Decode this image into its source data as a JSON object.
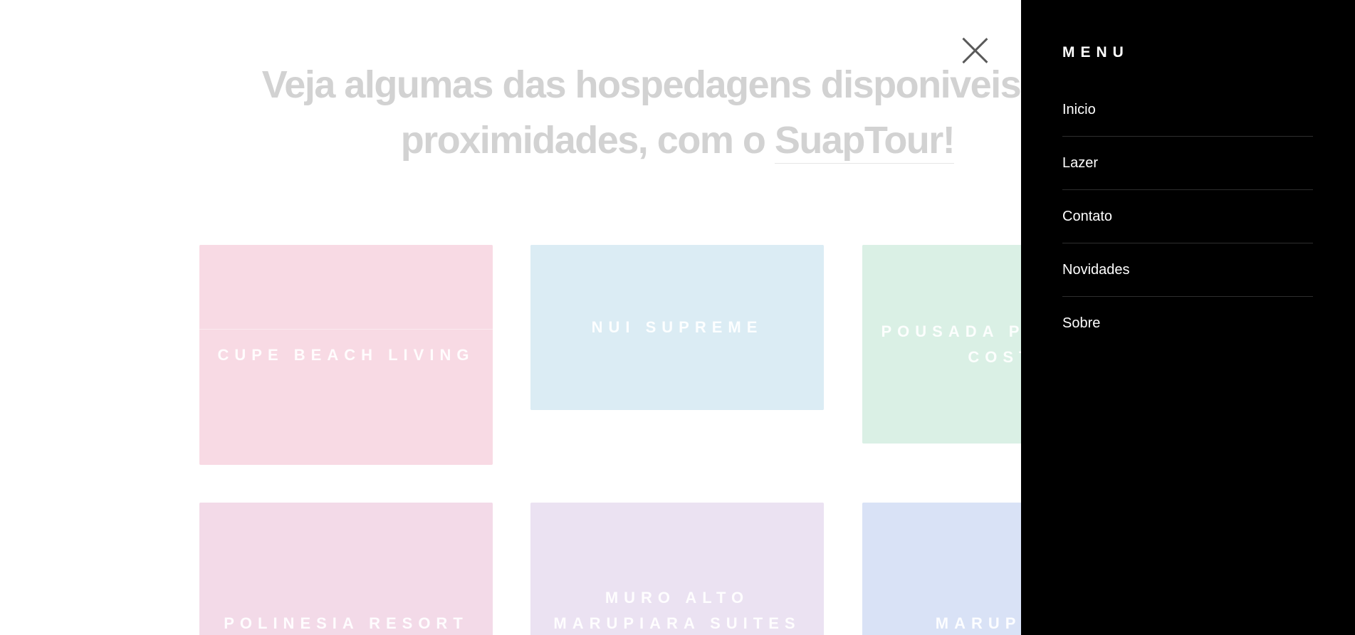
{
  "heading": {
    "line1": "Veja algumas das hospedagens disponiveis nas",
    "line2_prefix": "proximidades, com o ",
    "brand": "SuapTour!"
  },
  "cards": [
    {
      "title": "CUPE BEACH LIVING",
      "color": "#f4c7d6"
    },
    {
      "title": "NUI SUPREME",
      "color": "#c8e2ef"
    },
    {
      "title": "POUSADA PORTO DA COSTA",
      "color": "#c6e9d8"
    },
    {
      "title": "POLINESIA RESORT",
      "color": "#edc6dc"
    },
    {
      "title": "MURO ALTO MARUPIARA SUITES",
      "color": "#e0d3ec"
    },
    {
      "title": "MARUPIARA",
      "color": "#c5d3f1"
    }
  ],
  "menu": {
    "title": "MENU",
    "items": [
      {
        "label": "Inicio"
      },
      {
        "label": "Lazer"
      },
      {
        "label": "Contato"
      },
      {
        "label": "Novidades"
      },
      {
        "label": "Sobre"
      }
    ]
  },
  "colors": {
    "menu_background": "#000000",
    "heading_text": "#d2d2d2",
    "close_icon": "#5a5a5a"
  }
}
